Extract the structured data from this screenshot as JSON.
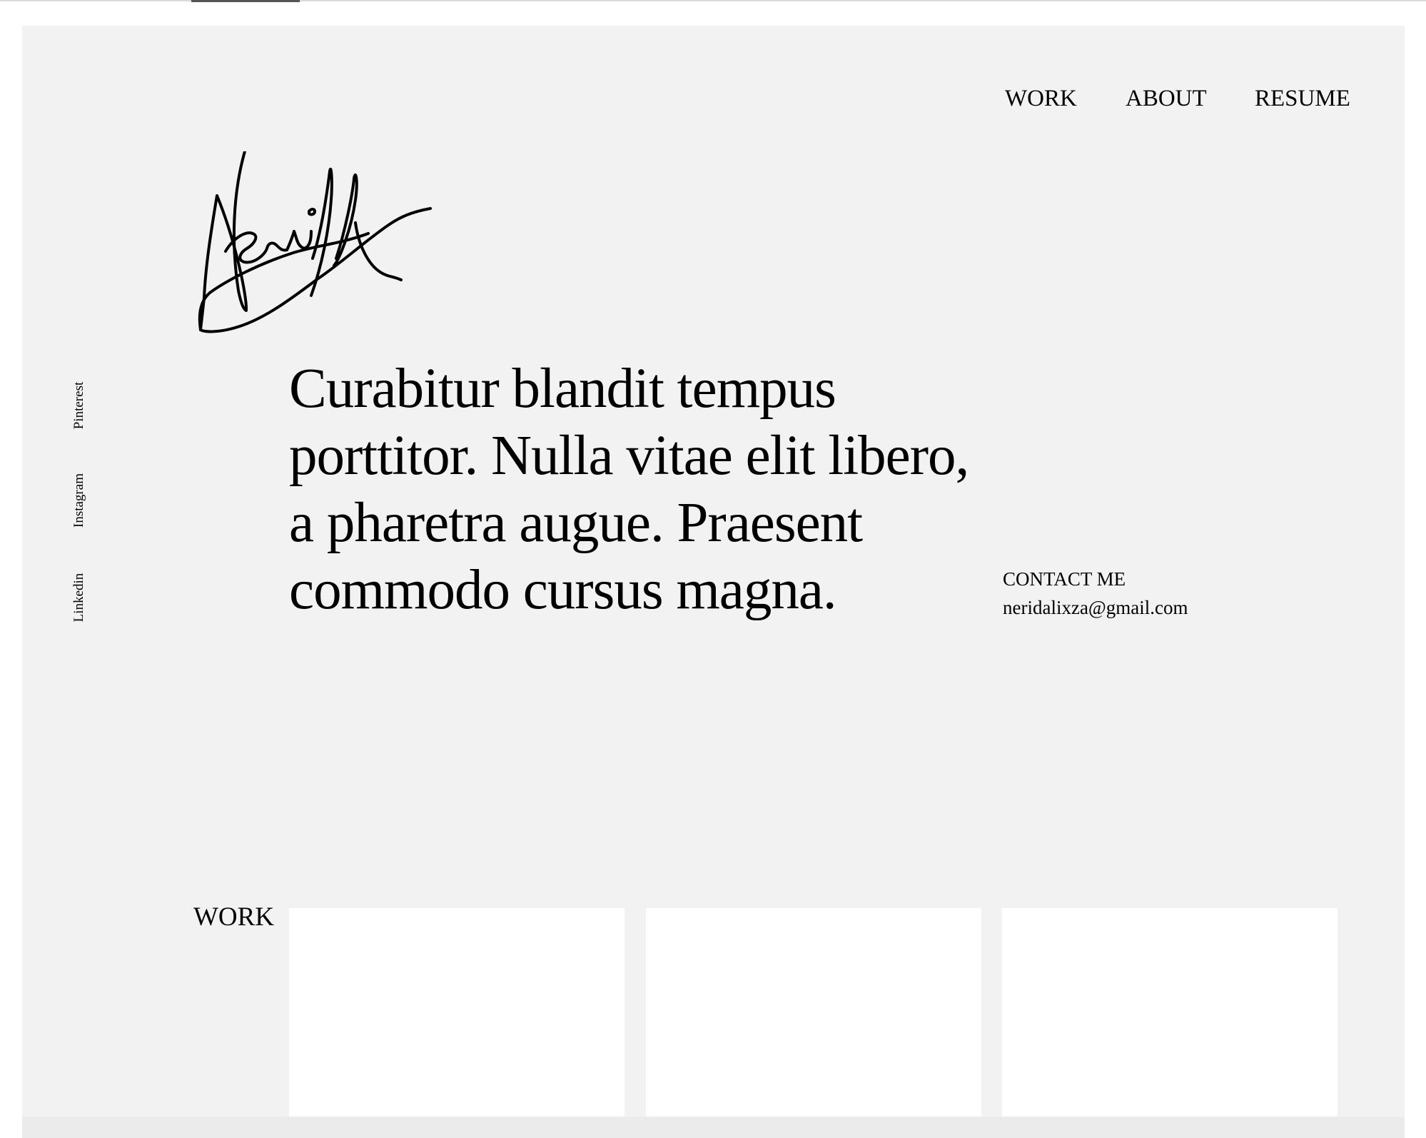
{
  "nav": {
    "items": [
      {
        "label": "WORK"
      },
      {
        "label": "ABOUT"
      },
      {
        "label": "RESUME"
      }
    ]
  },
  "logo": {
    "signature_text": "Neri"
  },
  "social": {
    "items": [
      {
        "label": "Pinterest"
      },
      {
        "label": "Instagram"
      },
      {
        "label": "Linkedin"
      }
    ]
  },
  "hero": {
    "text": "Curabitur blandit tempus porttitor. Nulla vitae elit libero, a pharetra augue. Praesent commodo cursus magna."
  },
  "contact": {
    "label": "CONTACT ME",
    "email": "neridalixza@gmail.com"
  },
  "work": {
    "heading": "WORK",
    "cards": [
      {
        "title": ""
      },
      {
        "title": ""
      },
      {
        "title": ""
      }
    ]
  },
  "colors": {
    "background": "#f2f2f2",
    "card": "#ffffff",
    "text": "#000000"
  }
}
